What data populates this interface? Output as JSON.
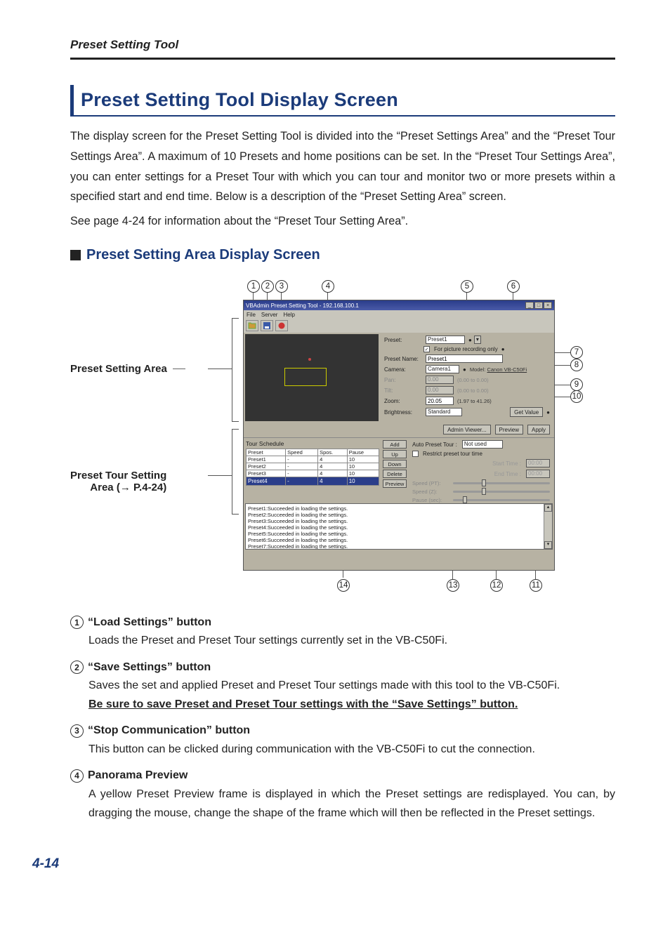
{
  "running_head": "Preset Setting Tool",
  "h1": "Preset Setting Tool Display Screen",
  "intro": "The display screen for the Preset Setting Tool is divided into the “Preset Settings Area” and the “Preset Tour Settings Area”. A maximum of 10 Presets and home positions can be set. In the “Preset Tour Settings Area”, you can enter settings for a Preset Tour with which you can tour and monitor two or more presets within a specified start and end time. Below is a description of the “Preset Setting Area” screen.",
  "intro2": "See page 4-24 for information about the “Preset Tour Setting Area”.",
  "h2": "Preset Setting Area Display Screen",
  "callouts": {
    "left1": "Preset Setting Area",
    "left2": "Preset Tour Setting Area (→ P.4-24)",
    "left2_line1": "Preset Tour Setting",
    "left2_line2": "Area (→ P.4-24)"
  },
  "window": {
    "title": "VBAdmin Preset Setting Tool - 192.168.100.1",
    "menus": {
      "file": "File",
      "server": "Server",
      "help": "Help"
    },
    "toolbar": {
      "load": "load-settings-icon",
      "save": "save-settings-icon",
      "stop": "stop-communication-icon"
    },
    "fields": {
      "preset_label": "Preset:",
      "preset_value": "Preset1",
      "record_check": "For picture recording only",
      "presetname_label": "Preset Name:",
      "presetname_value": "Preset1",
      "camera_label": "Camera:",
      "camera_value": "Camera1",
      "model_label": "Model:",
      "model_value": "Canon VB-C50Fi",
      "pan_label": "Pan:",
      "pan_value": "0.00",
      "pan_range": "(0.00 to 0.00)",
      "tilt_label": "Tilt:",
      "tilt_value": "0.00",
      "tilt_range": "(0.00 to 0.00)",
      "zoom_label": "Zoom:",
      "zoom_value": "20.05",
      "zoom_range": "(1.97 to 41.26)",
      "brightness_label": "Brightness:",
      "brightness_value": "Standard",
      "getvalue": "Get Value"
    },
    "btnrow": {
      "admin": "Admin Viewer...",
      "preview": "Preview",
      "apply": "Apply"
    },
    "tour": {
      "sched_label": "Tour Schedule",
      "headers": {
        "preset": "Preset",
        "speed": "Speed",
        "spos": "Spos.",
        "pause": "Pause"
      },
      "rows": [
        {
          "preset": "Preset1",
          "speed": "-",
          "spos": "4",
          "pause": "10"
        },
        {
          "preset": "Preset2",
          "speed": "-",
          "spos": "4",
          "pause": "10"
        },
        {
          "preset": "Preset3",
          "speed": "-",
          "spos": "4",
          "pause": "10"
        },
        {
          "preset": "Preset4",
          "speed": "-",
          "spos": "4",
          "pause": "10"
        }
      ],
      "btns": {
        "add": "Add",
        "up": "Up",
        "down": "Down",
        "delete": "Delete",
        "preview": "Preview"
      },
      "auto_label": "Auto Preset Tour :",
      "auto_value": "Not used",
      "restrict": "Restrict preset tour time",
      "start_label": "Start Time :",
      "start_value": "00:00",
      "end_label": "End Time :",
      "end_value": "00:00",
      "s1": "Speed (PT):",
      "s2": "Speed (Z):",
      "s3": "Pause (sec):"
    },
    "log": [
      "Preset1:Succeeded in loading the settings.",
      "Preset2:Succeeded in loading the settings.",
      "Preset3:Succeeded in loading the settings.",
      "Preset4:Succeeded in loading the settings.",
      "Preset5:Succeeded in loading the settings.",
      "Preset6:Succeeded in loading the settings.",
      "Preset7:Succeeded in loading the settings."
    ]
  },
  "desc": [
    {
      "n": "1",
      "title": "“Load Settings” button",
      "body": "Loads the Preset and Preset Tour settings currently set in the VB-C50Fi."
    },
    {
      "n": "2",
      "title": "“Save Settings” button",
      "body": "Saves the set and applied Preset and Preset Tour settings made with this tool to the VB-C50Fi.",
      "under": "Be sure to save Preset and Preset Tour settings with the “Save Settings” button."
    },
    {
      "n": "3",
      "title": "“Stop Communication” button",
      "body": "This button can be clicked during communication with the VB-C50Fi to cut the connection."
    },
    {
      "n": "4",
      "title": "Panorama Preview",
      "body": "A yellow Preset Preview frame is displayed in which the Preset settings are redisplayed. You can, by dragging the mouse, change the shape of the frame which will then be reflected in the Preset settings."
    }
  ],
  "page_number": "4-14",
  "markers": {
    "top": [
      "1",
      "2",
      "3",
      "4",
      "5",
      "6"
    ],
    "right": [
      "7",
      "8",
      "9",
      "10"
    ],
    "bottom": [
      "14",
      "13",
      "12",
      "11"
    ]
  }
}
